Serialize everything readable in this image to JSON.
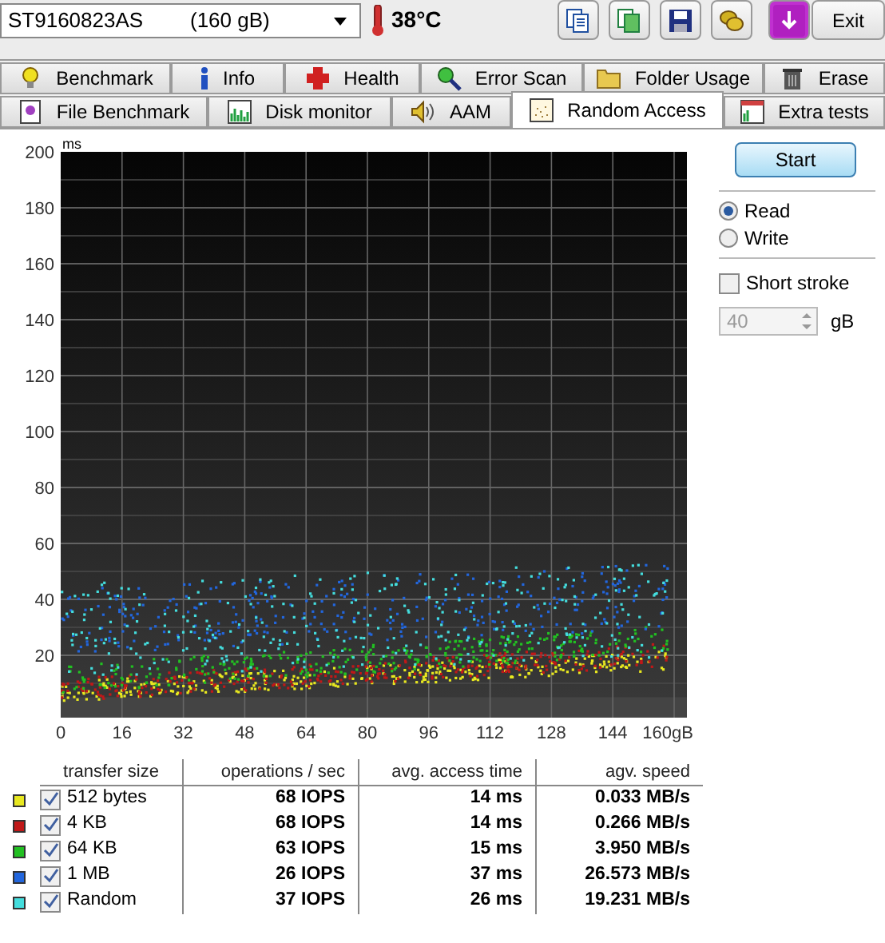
{
  "drive_select": {
    "model": "ST9160823AS",
    "capacity": "(160 gB)"
  },
  "temperature": "38°C",
  "exit_button": "Exit",
  "tab_rows": [
    [
      {
        "label": "Benchmark",
        "selected": false
      },
      {
        "label": "Info",
        "selected": false
      },
      {
        "label": "Health",
        "selected": false
      },
      {
        "label": "Error Scan",
        "selected": false
      },
      {
        "label": "Folder Usage",
        "selected": false
      },
      {
        "label": "Erase",
        "selected": false
      }
    ],
    [
      {
        "label": "File Benchmark",
        "selected": false
      },
      {
        "label": "Disk monitor",
        "selected": false
      },
      {
        "label": "AAM",
        "selected": false
      },
      {
        "label": "Random Access",
        "selected": true
      },
      {
        "label": "Extra tests",
        "selected": false
      }
    ]
  ],
  "chart": {
    "y_unit": "ms",
    "y_ticks": [
      "200",
      "180",
      "160",
      "140",
      "120",
      "100",
      "80",
      "60",
      "40",
      "20"
    ],
    "x_ticks": [
      "0",
      "16",
      "32",
      "48",
      "64",
      "80",
      "96",
      "112",
      "128",
      "144",
      "160gB"
    ]
  },
  "start_button": "Start",
  "mode": [
    {
      "label": "Read",
      "selected": true
    },
    {
      "label": "Write",
      "selected": false
    }
  ],
  "short_stroke": {
    "label": "Short stroke",
    "checked": false
  },
  "stroke_size": {
    "value": "40",
    "unit": "gB",
    "disabled": true
  },
  "table": {
    "columns": [
      "transfer size",
      "operations / sec",
      "avg. access time",
      "agv. speed"
    ],
    "rows": [
      {
        "color": "#e8e820",
        "checked": true,
        "size": "512 bytes",
        "ops": "68 IOPS",
        "time": "14 ms",
        "speed": "0.033 MB/s"
      },
      {
        "color": "#c01818",
        "checked": true,
        "size": "4 KB",
        "ops": "68 IOPS",
        "time": "14 ms",
        "speed": "0.266 MB/s"
      },
      {
        "color": "#22c022",
        "checked": true,
        "size": "64 KB",
        "ops": "63 IOPS",
        "time": "15 ms",
        "speed": "3.950 MB/s"
      },
      {
        "color": "#2266dd",
        "checked": true,
        "size": "1 MB",
        "ops": "26 IOPS",
        "time": "37 ms",
        "speed": "26.573 MB/s"
      },
      {
        "color": "#44dddd",
        "checked": true,
        "size": "Random",
        "ops": "37 IOPS",
        "time": "26 ms",
        "speed": "19.231 MB/s"
      }
    ]
  }
}
